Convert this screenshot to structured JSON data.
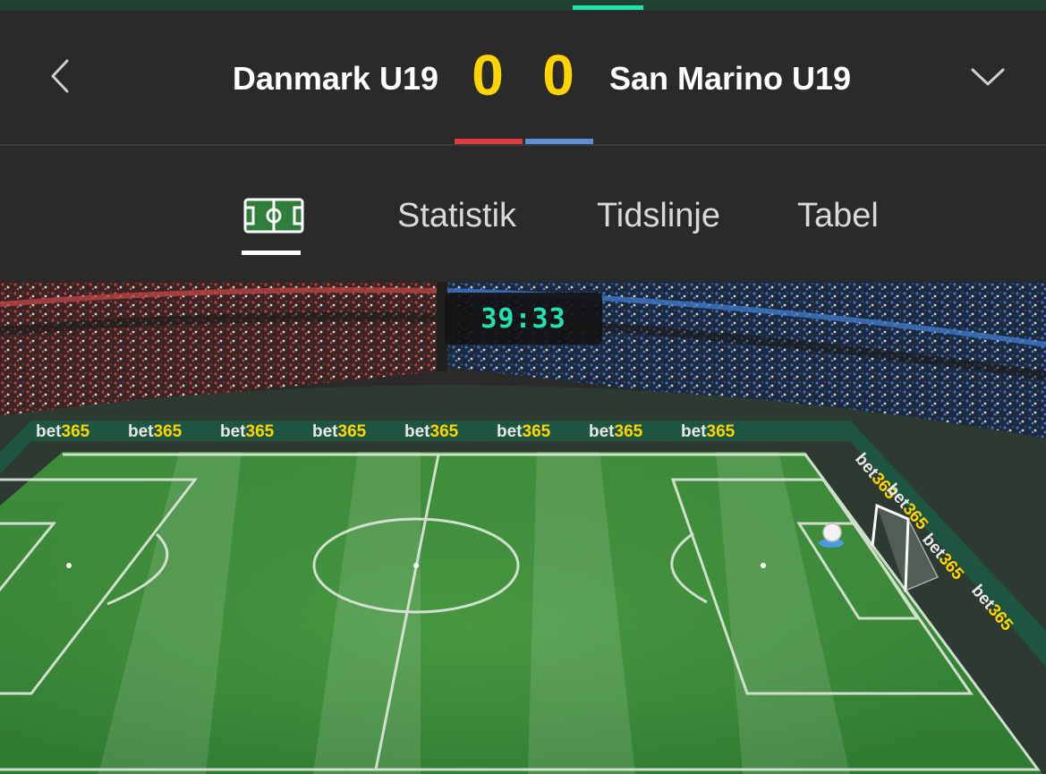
{
  "match": {
    "home_team": "Danmark U19",
    "away_team": "San Marino U19",
    "home_score": "0",
    "away_score": "0",
    "home_color": "#e23a3a",
    "away_color": "#5c8fd6",
    "clock": "39:33"
  },
  "header": {
    "back_icon": "chevron-left-icon",
    "expand_icon": "chevron-down-icon"
  },
  "tabs": [
    {
      "id": "pitch",
      "icon": "pitch-icon",
      "active": true
    },
    {
      "id": "statistik",
      "label": "Statistik",
      "active": false
    },
    {
      "id": "tidslinje",
      "label": "Tidslinje",
      "active": false
    },
    {
      "id": "tabel",
      "label": "Tabel",
      "active": false
    }
  ],
  "stadium": {
    "ad_board_text": "bet365",
    "pitch_color": "#3f8b3a",
    "accent_color": "#20e3b0",
    "score_color": "#ffd400"
  }
}
